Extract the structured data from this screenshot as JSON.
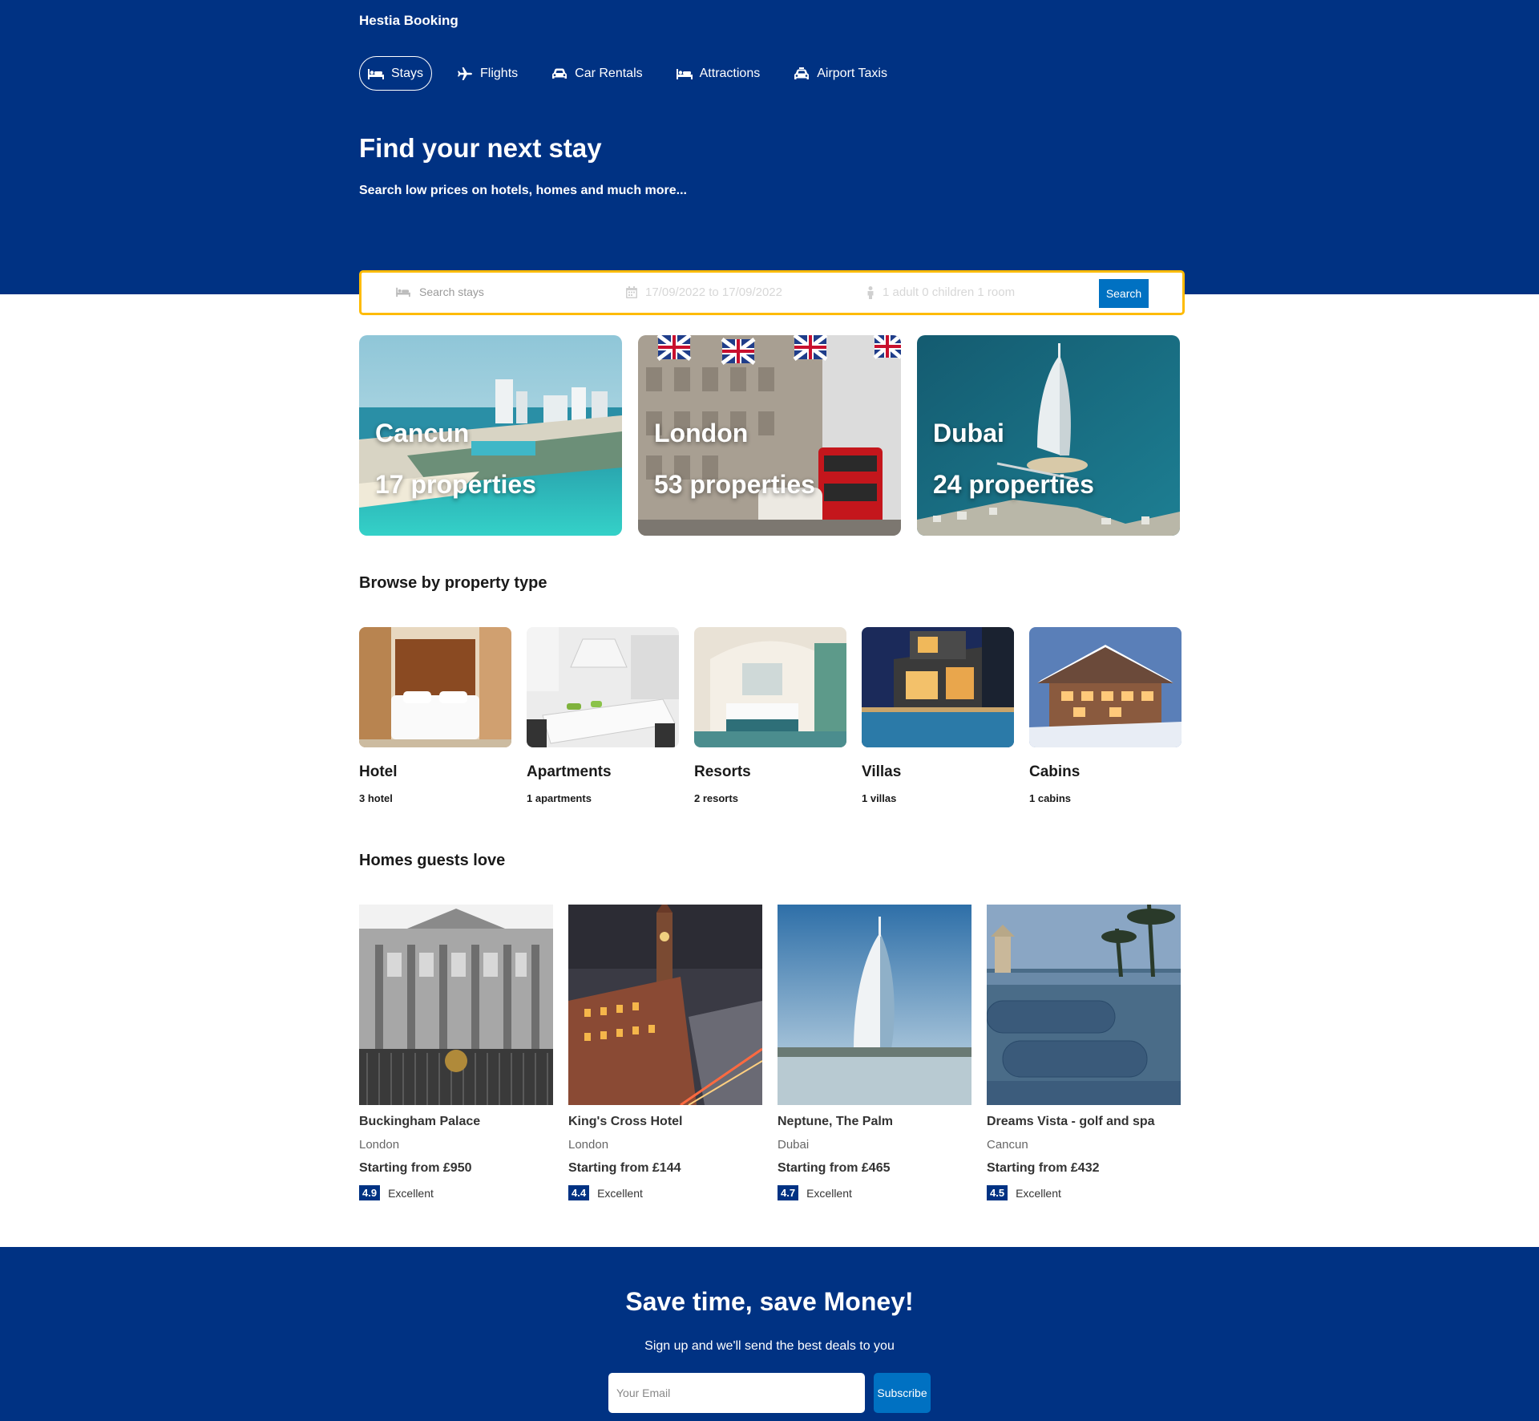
{
  "brand": "Hestia Booking",
  "nav": {
    "items": [
      {
        "label": "Stays",
        "icon": "bed-icon",
        "active": true
      },
      {
        "label": "Flights",
        "icon": "plane-icon",
        "active": false
      },
      {
        "label": "Car Rentals",
        "icon": "car-icon",
        "active": false
      },
      {
        "label": "Attractions",
        "icon": "bed-icon",
        "active": false
      },
      {
        "label": "Airport Taxis",
        "icon": "taxi-icon",
        "active": false
      }
    ]
  },
  "hero": {
    "title": "Find your next stay",
    "subtitle": "Search low prices on hotels, homes and much more..."
  },
  "search": {
    "destination_placeholder": "Search stays",
    "dates": "17/09/2022 to 17/09/2022",
    "guests": "1 adult 0 children 1 room",
    "button": "Search"
  },
  "featured": [
    {
      "city": "Cancun",
      "count": "17 properties"
    },
    {
      "city": "London",
      "count": "53 properties"
    },
    {
      "city": "Dubai",
      "count": "24 properties"
    }
  ],
  "property_types": {
    "title": "Browse by property type",
    "items": [
      {
        "name": "Hotel",
        "count": "3 hotel"
      },
      {
        "name": "Apartments",
        "count": "1 apartments"
      },
      {
        "name": "Resorts",
        "count": "2 resorts"
      },
      {
        "name": "Villas",
        "count": "1 villas"
      },
      {
        "name": "Cabins",
        "count": "1 cabins"
      }
    ]
  },
  "homes": {
    "title": "Homes guests love",
    "items": [
      {
        "name": "Buckingham Palace",
        "location": "London",
        "price": "Starting from £950",
        "score": "4.9",
        "rating_label": "Excellent"
      },
      {
        "name": "King's Cross Hotel",
        "location": "London",
        "price": "Starting from £144",
        "score": "4.4",
        "rating_label": "Excellent"
      },
      {
        "name": "Neptune, The Palm",
        "location": "Dubai",
        "price": "Starting from £465",
        "score": "4.7",
        "rating_label": "Excellent"
      },
      {
        "name": "Dreams Vista - golf and spa",
        "location": "Cancun",
        "price": "Starting from £432",
        "score": "4.5",
        "rating_label": "Excellent"
      }
    ]
  },
  "newsletter": {
    "title": "Save time, save Money!",
    "subtitle": "Sign up and we'll send the best deals to you",
    "email_placeholder": "Your Email",
    "button": "Subscribe"
  },
  "colors": {
    "primary": "#003283",
    "button": "#0071c2",
    "search_border": "#febb02"
  }
}
